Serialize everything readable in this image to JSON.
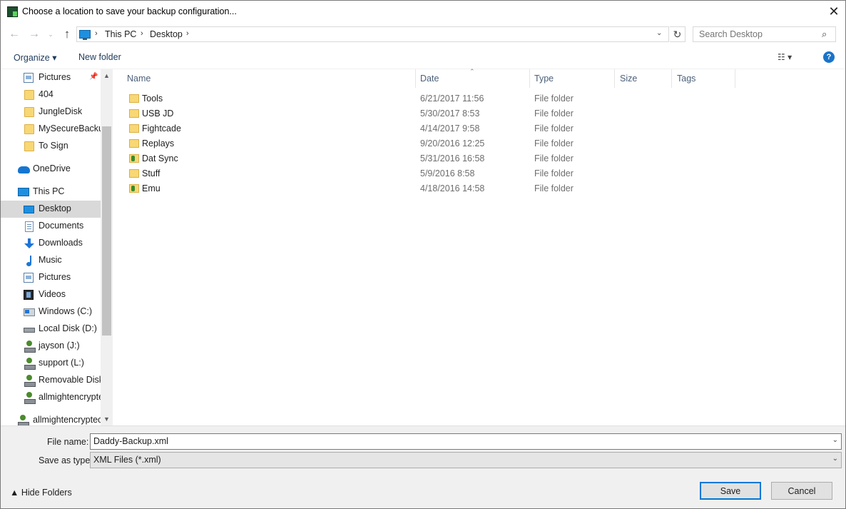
{
  "window": {
    "title": "Choose a location to save your backup configuration...",
    "close_glyph": "✕"
  },
  "nav": {
    "back_glyph": "←",
    "forward_glyph": "→",
    "recent_glyph": "⌄",
    "up_glyph": "↑",
    "breadcrumb": [
      "This PC",
      "Desktop"
    ],
    "crumb_sep": "›",
    "dropdown_glyph": "⌄",
    "refresh_glyph": "↻",
    "search_placeholder": "Search Desktop",
    "search_glyph": "⌕"
  },
  "toolbar": {
    "organize_label": "Organize ▾",
    "new_folder_label": "New folder",
    "view_glyph": "☷ ▾",
    "help_glyph": "?"
  },
  "sidebar": {
    "items": [
      {
        "label": "Pictures",
        "icon": "pictures-icon",
        "pinned": true
      },
      {
        "label": "404",
        "icon": "folder-icon"
      },
      {
        "label": "JungleDisk",
        "icon": "folder-icon"
      },
      {
        "label": "MySecureBackup",
        "icon": "folder-icon"
      },
      {
        "label": "To Sign",
        "icon": "folder-icon"
      },
      {
        "label": "OneDrive",
        "icon": "onedrive-icon"
      },
      {
        "label": "This PC",
        "icon": "this-pc-icon"
      },
      {
        "label": "Desktop",
        "icon": "desktop-icon",
        "selected": true
      },
      {
        "label": "Documents",
        "icon": "documents-icon"
      },
      {
        "label": "Downloads",
        "icon": "downloads-icon"
      },
      {
        "label": "Music",
        "icon": "music-icon"
      },
      {
        "label": "Pictures",
        "icon": "pictures-icon"
      },
      {
        "label": "Videos",
        "icon": "videos-icon"
      },
      {
        "label": "Windows (C:)",
        "icon": "windows-drive-icon"
      },
      {
        "label": "Local Disk (D:)",
        "icon": "disk-icon"
      },
      {
        "label": "jayson (J:)",
        "icon": "network-drive-icon"
      },
      {
        "label": "support (L:)",
        "icon": "network-drive-icon"
      },
      {
        "label": "Removable Disk",
        "icon": "network-drive-icon"
      },
      {
        "label": "allmightencrypted",
        "icon": "network-drive-icon"
      },
      {
        "label": "allmightencryptec",
        "icon": "network-drive-icon"
      }
    ],
    "pin_glyph": "📌",
    "scroll_up_glyph": "▲",
    "scroll_down_glyph": "▼"
  },
  "filelist": {
    "columns": [
      "Name",
      "Date",
      "Type",
      "Size",
      "Tags"
    ],
    "sort_glyph": "⌃",
    "rows": [
      {
        "name": "Tools",
        "date": "6/21/2017 11:56",
        "type": "File folder",
        "icon": "folder-icon"
      },
      {
        "name": "USB JD",
        "date": "5/30/2017 8:53",
        "type": "File folder",
        "icon": "folder-icon"
      },
      {
        "name": "Fightcade",
        "date": "4/14/2017 9:58",
        "type": "File folder",
        "icon": "folder-icon"
      },
      {
        "name": "Replays",
        "date": "9/20/2016 12:25",
        "type": "File folder",
        "icon": "folder-icon"
      },
      {
        "name": "Dat Sync",
        "date": "5/31/2016 16:58",
        "type": "File folder",
        "icon": "sync-folder-icon"
      },
      {
        "name": "Stuff",
        "date": "5/9/2016 8:58",
        "type": "File folder",
        "icon": "folder-icon"
      },
      {
        "name": "Emu",
        "date": "4/18/2016 14:58",
        "type": "File folder",
        "icon": "sync-folder-icon"
      }
    ]
  },
  "bottom": {
    "file_name_label": "File name:",
    "file_name_value": "Daddy-Backup.xml",
    "save_type_label": "Save as type:",
    "save_type_value": "XML Files (*.xml)",
    "dropdown_glyph": "⌄",
    "hide_folders_label": "▲  Hide Folders",
    "save_label": "Save",
    "cancel_label": "Cancel"
  }
}
